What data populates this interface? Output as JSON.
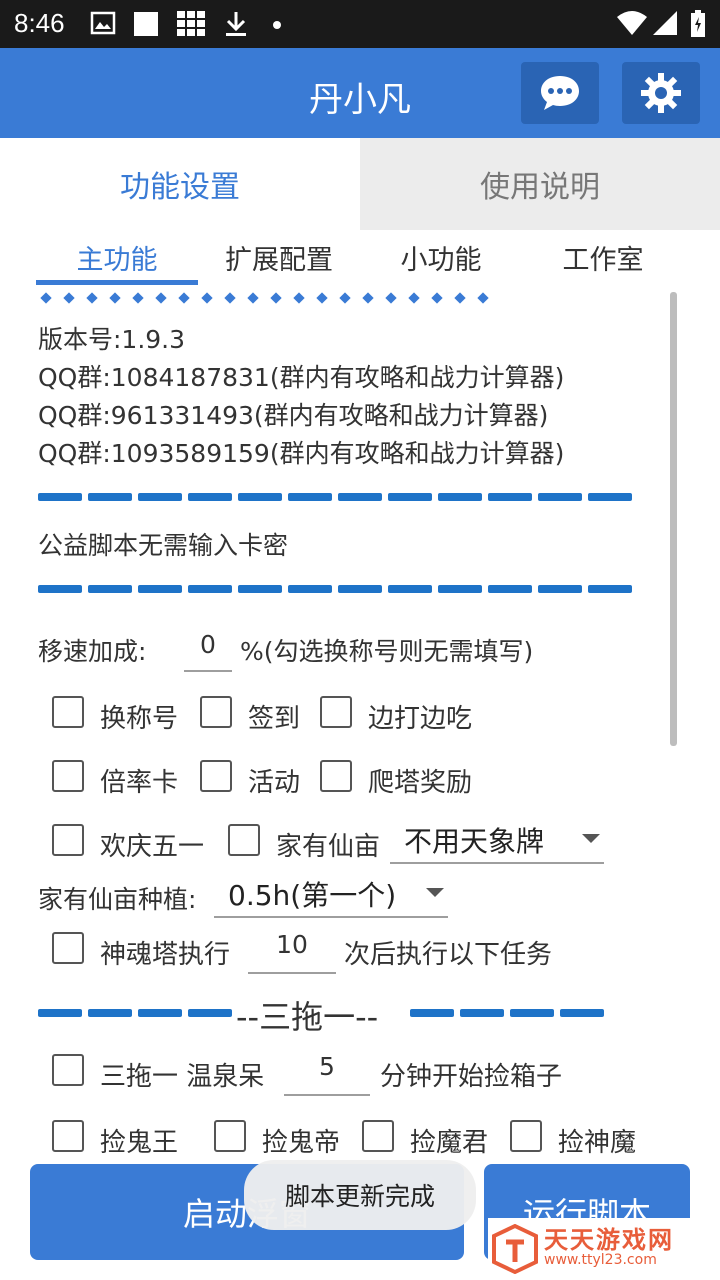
{
  "status_bar": {
    "time": "8:46"
  },
  "app": {
    "title": "丹小凡"
  },
  "main_tabs": [
    {
      "label": "功能设置"
    },
    {
      "label": "使用说明"
    }
  ],
  "sub_tabs": [
    {
      "label": "主功能"
    },
    {
      "label": "扩展配置"
    },
    {
      "label": "小功能"
    },
    {
      "label": "工作室"
    }
  ],
  "info": {
    "version": "版本号:1.9.3",
    "qq1": "QQ群:1084187831(群内有攻略和战力计算器)",
    "qq2": "QQ群:961331493(群内有攻略和战力计算器)",
    "qq3": "QQ群:1093589159(群内有攻略和战力计算器)",
    "notice": "公益脚本无需输入卡密"
  },
  "speed": {
    "label": "移速加成:",
    "value": "0",
    "hint": "%(勾选换称号则无需填写)"
  },
  "checks_row1": [
    "换称号",
    "签到",
    "边打边吃"
  ],
  "checks_row2": [
    "倍率卡",
    "活动",
    "爬塔奖励"
  ],
  "checks_row3": {
    "a": "欢庆五一",
    "b": "家有仙亩",
    "spinner": "不用天象牌"
  },
  "planting": {
    "label": "家有仙亩种植:",
    "spinner": "0.5h(第一个)"
  },
  "tower": {
    "label": "神魂塔执行",
    "value": "10",
    "suffix": "次后执行以下任务"
  },
  "section": {
    "title": "--三拖一--"
  },
  "three": {
    "label": "三拖一 温泉呆",
    "value": "5",
    "suffix": "分钟开始捡箱子"
  },
  "pick": [
    "捡鬼王",
    "捡鬼帝",
    "捡魔君",
    "捡神魔"
  ],
  "buttons": {
    "start": "启动浮窗",
    "run": "运行脚本"
  },
  "toast": "脚本更新完成",
  "watermark": {
    "name": "天天游戏网",
    "url": "www.ttyl23.com"
  },
  "colors": {
    "primary": "#3a7bd5",
    "dark_primary": "#2a64b4",
    "accent_orange": "#e85d3a"
  }
}
